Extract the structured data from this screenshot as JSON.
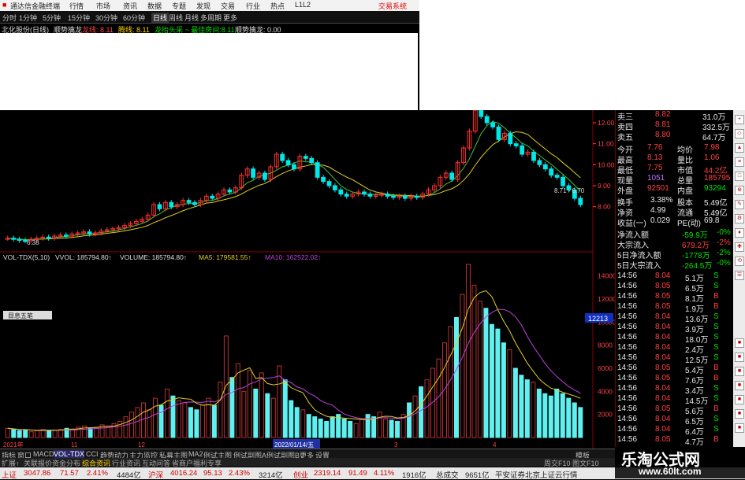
{
  "titlebar": {
    "app_title": "通达信金融终端",
    "menu": [
      "行情",
      "市场",
      "资讯",
      "数据",
      "专题",
      "发现",
      "交易",
      "行业",
      "热点",
      "L1L2"
    ],
    "login": "交易系统"
  },
  "toolbar": {
    "items": [
      "分时",
      "1分钟",
      "5分钟",
      "15分钟",
      "30分钟",
      "60分钟",
      "日线",
      "周线",
      "月线",
      "多周期",
      "更多"
    ],
    "active": "日线"
  },
  "indicator_line": {
    "stock": "北化股份(日线)",
    "formula": "顺势擒龙",
    "s1": "龙线: 8.11",
    "s2": "腾线: 8.11",
    "s3": "龙抬头采 ~ 最佳房间:8.11",
    "s4": "顺势擒龙: 0.00"
  },
  "price_chart": {
    "y_ticks": [
      "12.00",
      "11.00",
      "10.00",
      "9.00",
      "8.00"
    ],
    "low_label": "6.38",
    "marker_label": "8.71 - 8.70"
  },
  "volume_chart": {
    "header": "VOL-TDX(5,10)",
    "vvol": "VVOL: 185794.80↑",
    "volume": "VOLUME: 185794.80↑",
    "ma5": "MA5: 179581.55↑",
    "ma10": "MA10: 162522.02↑",
    "y_ticks": [
      "14000",
      "12000",
      "10000",
      "8000",
      "6000",
      "4000",
      "2000"
    ],
    "cursor_value": "12213",
    "legend_tag": "目息五笔",
    "date_label": "2022/01/14/五",
    "axis_dates": [
      "2021年",
      "11",
      "12",
      "3",
      "4"
    ]
  },
  "chart_data": [
    {
      "type": "candlestick",
      "title": "北化股份(日线)",
      "ylim": [
        6.0,
        12.6
      ],
      "series": [
        {
          "name": "close",
          "values": [
            6.5,
            6.45,
            6.4,
            6.38,
            6.45,
            6.5,
            6.55,
            6.5,
            6.6,
            6.65,
            6.6,
            6.7,
            6.75,
            6.8,
            6.7,
            6.75,
            6.85,
            6.9,
            6.95,
            7.0,
            7.1,
            7.2,
            7.3,
            7.4,
            7.6,
            8.1,
            7.9,
            8.2,
            8.0,
            8.1,
            8.3,
            8.2,
            8.1,
            8.3,
            8.5,
            8.4,
            8.6,
            8.8,
            8.7,
            8.9,
            9.5,
            9.8,
            9.4,
            9.6,
            9.3,
            9.9,
            10.5,
            10.2,
            10.0,
            9.8,
            10.4,
            10.3,
            10.1,
            9.4,
            9.2,
            9.0,
            8.8,
            8.6,
            8.5,
            8.6,
            8.7,
            8.6,
            8.5,
            8.55,
            8.6,
            8.5,
            8.45,
            8.5,
            8.4,
            8.5,
            8.45,
            8.6,
            8.8,
            9.0,
            9.4,
            9.6,
            9.3,
            10.1,
            10.8,
            11.6,
            12.6,
            12.3,
            12.0,
            11.8,
            11.2,
            11.5,
            11.0,
            10.9,
            10.5,
            10.6,
            10.2,
            10.0,
            9.8,
            9.5,
            9.4,
            9.0,
            8.8,
            8.4,
            8.1
          ]
        }
      ]
    },
    {
      "type": "bar",
      "title": "VOL-TDX(5,10)",
      "ylim": [
        0,
        15000
      ],
      "series": [
        {
          "name": "VOL",
          "values": [
            800,
            700,
            600,
            650,
            500,
            600,
            700,
            600,
            650,
            700,
            800,
            750,
            900,
            1000,
            800,
            900,
            1100,
            1000,
            1200,
            1400,
            1800,
            2200,
            2600,
            3000,
            2400,
            3400,
            2800,
            4200,
            3600,
            3200,
            3000,
            2600,
            2400,
            2800,
            3400,
            2800,
            4800,
            8800,
            5200,
            6400,
            4000,
            5800,
            4200,
            5600,
            3800,
            3400,
            6200,
            5000,
            3200,
            2600,
            2400,
            2000,
            1800,
            1600,
            1400,
            1800,
            2000,
            1600,
            1400,
            1200,
            1600,
            2000,
            1800,
            2200,
            1600,
            1500,
            1400,
            2000,
            3000,
            3600,
            4400,
            5000,
            6000,
            6800,
            8200,
            9600,
            10400,
            12400,
            15000,
            13200,
            11800,
            11200,
            9800,
            9400,
            8200,
            7600,
            6000,
            5400,
            5000,
            4800,
            4200,
            3800,
            3600,
            4200,
            3800,
            3400,
            3000,
            2600
          ]
        }
      ]
    }
  ],
  "rpanel": {
    "quote_rows": [
      {
        "label": "卖三",
        "price": "8.82",
        "vol": "31.0万"
      },
      {
        "label": "卖四",
        "price": "8.81",
        "vol": "332.5万"
      },
      {
        "label": "卖五",
        "price": "8.80",
        "vol": "64.7万"
      }
    ],
    "stats": [
      {
        "l1": "今开",
        "v1": "7.76",
        "l2": "均价",
        "v2": "7.98"
      },
      {
        "l1": "最高",
        "v1": "8.13",
        "l2": "量比",
        "v2": "1.06"
      },
      {
        "l1": "最低",
        "v1": "7.75",
        "l2": "市值",
        "v2": "44.2亿"
      },
      {
        "l1": "现量",
        "v1": "1051",
        "l2": "总量",
        "v2": "185795"
      },
      {
        "l1": "外盘",
        "v1": "92501",
        "l2": "内盘",
        "v2": "93294"
      }
    ],
    "stats2": [
      {
        "l1": "换手",
        "v1": "3.38%",
        "l2": "股本",
        "v2": "5.49亿"
      },
      {
        "l1": "净资",
        "v1": "4.99",
        "l2": "流通",
        "v2": "5.49亿"
      },
      {
        "l1": "收益(一)",
        "v1": "0.029",
        "l2": "PE(动)",
        "v2": "69.8"
      }
    ],
    "flows": [
      {
        "label": "净流入额",
        "value": "-59.9万",
        "pct": "-0%"
      },
      {
        "label": "大宗流入",
        "value": "679.2万",
        "pct": "-2%"
      },
      {
        "label": "5日净流入额",
        "value": "-1778万",
        "pct": "-2%"
      },
      {
        "label": "5日大宗流入",
        "value": "-264.5万",
        "pct": "-0%"
      }
    ],
    "ticks": [
      {
        "t": "14:56",
        "p": "8.04",
        "v": "5.1万",
        "s": "S"
      },
      {
        "t": "14:56",
        "p": "8.05",
        "v": "6.5万",
        "s": "S"
      },
      {
        "t": "14:56",
        "p": "8.05",
        "v": "8.1万",
        "s": "B"
      },
      {
        "t": "14:56",
        "p": "8.05",
        "v": "1.9万",
        "s": "B"
      },
      {
        "t": "14:56",
        "p": "8.04",
        "v": "13.6万",
        "s": "S"
      },
      {
        "t": "14:56",
        "p": "8.04",
        "v": "3.9万",
        "s": "S"
      },
      {
        "t": "14:56",
        "p": "8.04",
        "v": "18.0万",
        "s": "S"
      },
      {
        "t": "14:56",
        "p": "8.04",
        "v": "2.4万",
        "s": "S"
      },
      {
        "t": "14:56",
        "p": "8.04",
        "v": "12.5万",
        "s": "S"
      },
      {
        "t": "14:56",
        "p": "8.05",
        "v": "5.4万",
        "s": "B"
      },
      {
        "t": "14:56",
        "p": "8.05",
        "v": "7.6万",
        "s": "B"
      },
      {
        "t": "14:56",
        "p": "8.04",
        "v": "3.4万",
        "s": "S"
      },
      {
        "t": "14:56",
        "p": "8.04",
        "v": "14.5万",
        "s": "S"
      },
      {
        "t": "14:56",
        "p": "8.05",
        "v": "5.6万",
        "s": "B"
      },
      {
        "t": "14:56",
        "p": "8.04",
        "v": "6.5万",
        "s": "S"
      },
      {
        "t": "14:56",
        "p": "8.04",
        "v": "6.4万",
        "s": "S"
      },
      {
        "t": "14:56",
        "p": "8.05",
        "v": "4.7万",
        "s": "B"
      }
    ]
  },
  "tabs": {
    "items": [
      "指标",
      "窗口",
      "MACD",
      "VOL-TDX",
      "CCI",
      "趋势动力",
      "主力监控",
      "私募主图",
      "MA2",
      "例试主图",
      "例试副图A",
      "例试副图B",
      "更多",
      "设置"
    ],
    "active": "VOL-TDX",
    "right": "模板"
  },
  "extra": {
    "items": [
      "扩展↑",
      "关联报价",
      "资金分布",
      "综合资讯",
      "行业资讯",
      "互动问答",
      "省商户福利专享"
    ],
    "right": "周交F10 图文F10"
  },
  "status": {
    "items": [
      {
        "name": "上证",
        "val": "3047.86",
        "chg": "71.57",
        "pct": "2.41%",
        "amt": "4484亿"
      },
      {
        "name": "沪深",
        "val": "4016.24",
        "chg": "95.13",
        "pct": "2.43%",
        "amt": "3214亿"
      },
      {
        "name": "创业",
        "val": "2319.14",
        "chg": "91.49",
        "pct": "4.11%",
        "amt": "1916亿"
      }
    ],
    "total_label": "总成交",
    "total": "9651亿",
    "server": "平安证券北京上证云行情"
  },
  "watermark": {
    "cn": "乐淘公式网",
    "url": "www.60lt.com"
  },
  "colors": {
    "up": "#ff3030",
    "down": "#00e8e8",
    "ma_yellow": "#e0d020",
    "ma_green": "#40c040",
    "ma_purple": "#c040e0",
    "vol_up": "#b83030",
    "vol_down": "#60f0f0"
  }
}
